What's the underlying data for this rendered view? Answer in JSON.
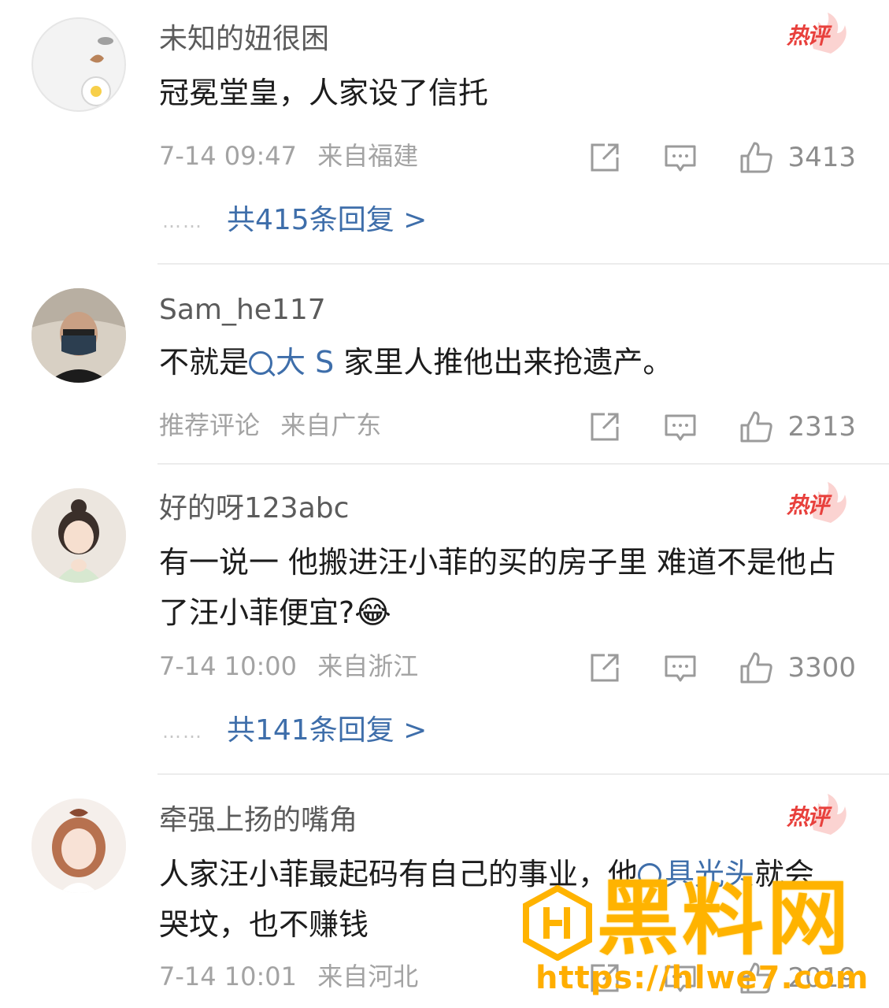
{
  "comments": [
    {
      "username": "未知的妞很困",
      "hot_badge": "热评",
      "text": "冠冕堂皇，人家设了信托",
      "time": "7-14 09:47",
      "location": "来自福建",
      "likes": "3413",
      "replies_label": "共415条回复 >"
    },
    {
      "username": "Sam_he117",
      "text_before": "不就是",
      "topic": "大 S",
      "text_after": "家里人推他出来抢遗产。",
      "recommend": "推荐评论",
      "location": "来自广东",
      "likes": "2313"
    },
    {
      "username": "好的呀123abc",
      "hot_badge": "热评",
      "text": "有一说一  他搬进汪小菲的买的房子里  难道不是他占了汪小菲便宜?",
      "emoji": "😂",
      "time": "7-14 10:00",
      "location": "来自浙江",
      "likes": "3300",
      "replies_label": "共141条回复 >"
    },
    {
      "username": "牵强上扬的嘴角",
      "hot_badge": "热评",
      "text_before": "人家汪小菲最起码有自己的事业，他",
      "topic": "具光头",
      "text_after": "就会哭坟，也不赚钱",
      "time": "7-14 10:01",
      "location": "来自河北",
      "likes": "2019"
    }
  ],
  "watermark": {
    "title": "黑料网",
    "url": "https://hlwe7.com"
  },
  "reply_dots": "……",
  "colors": {
    "link": "#3e6eaa",
    "hot_badge": "#e8403c",
    "watermark": "#ffb300"
  },
  "icons": [
    "share-icon",
    "comment-icon",
    "like-icon",
    "search-icon",
    "laugh-cry-emoji"
  ]
}
